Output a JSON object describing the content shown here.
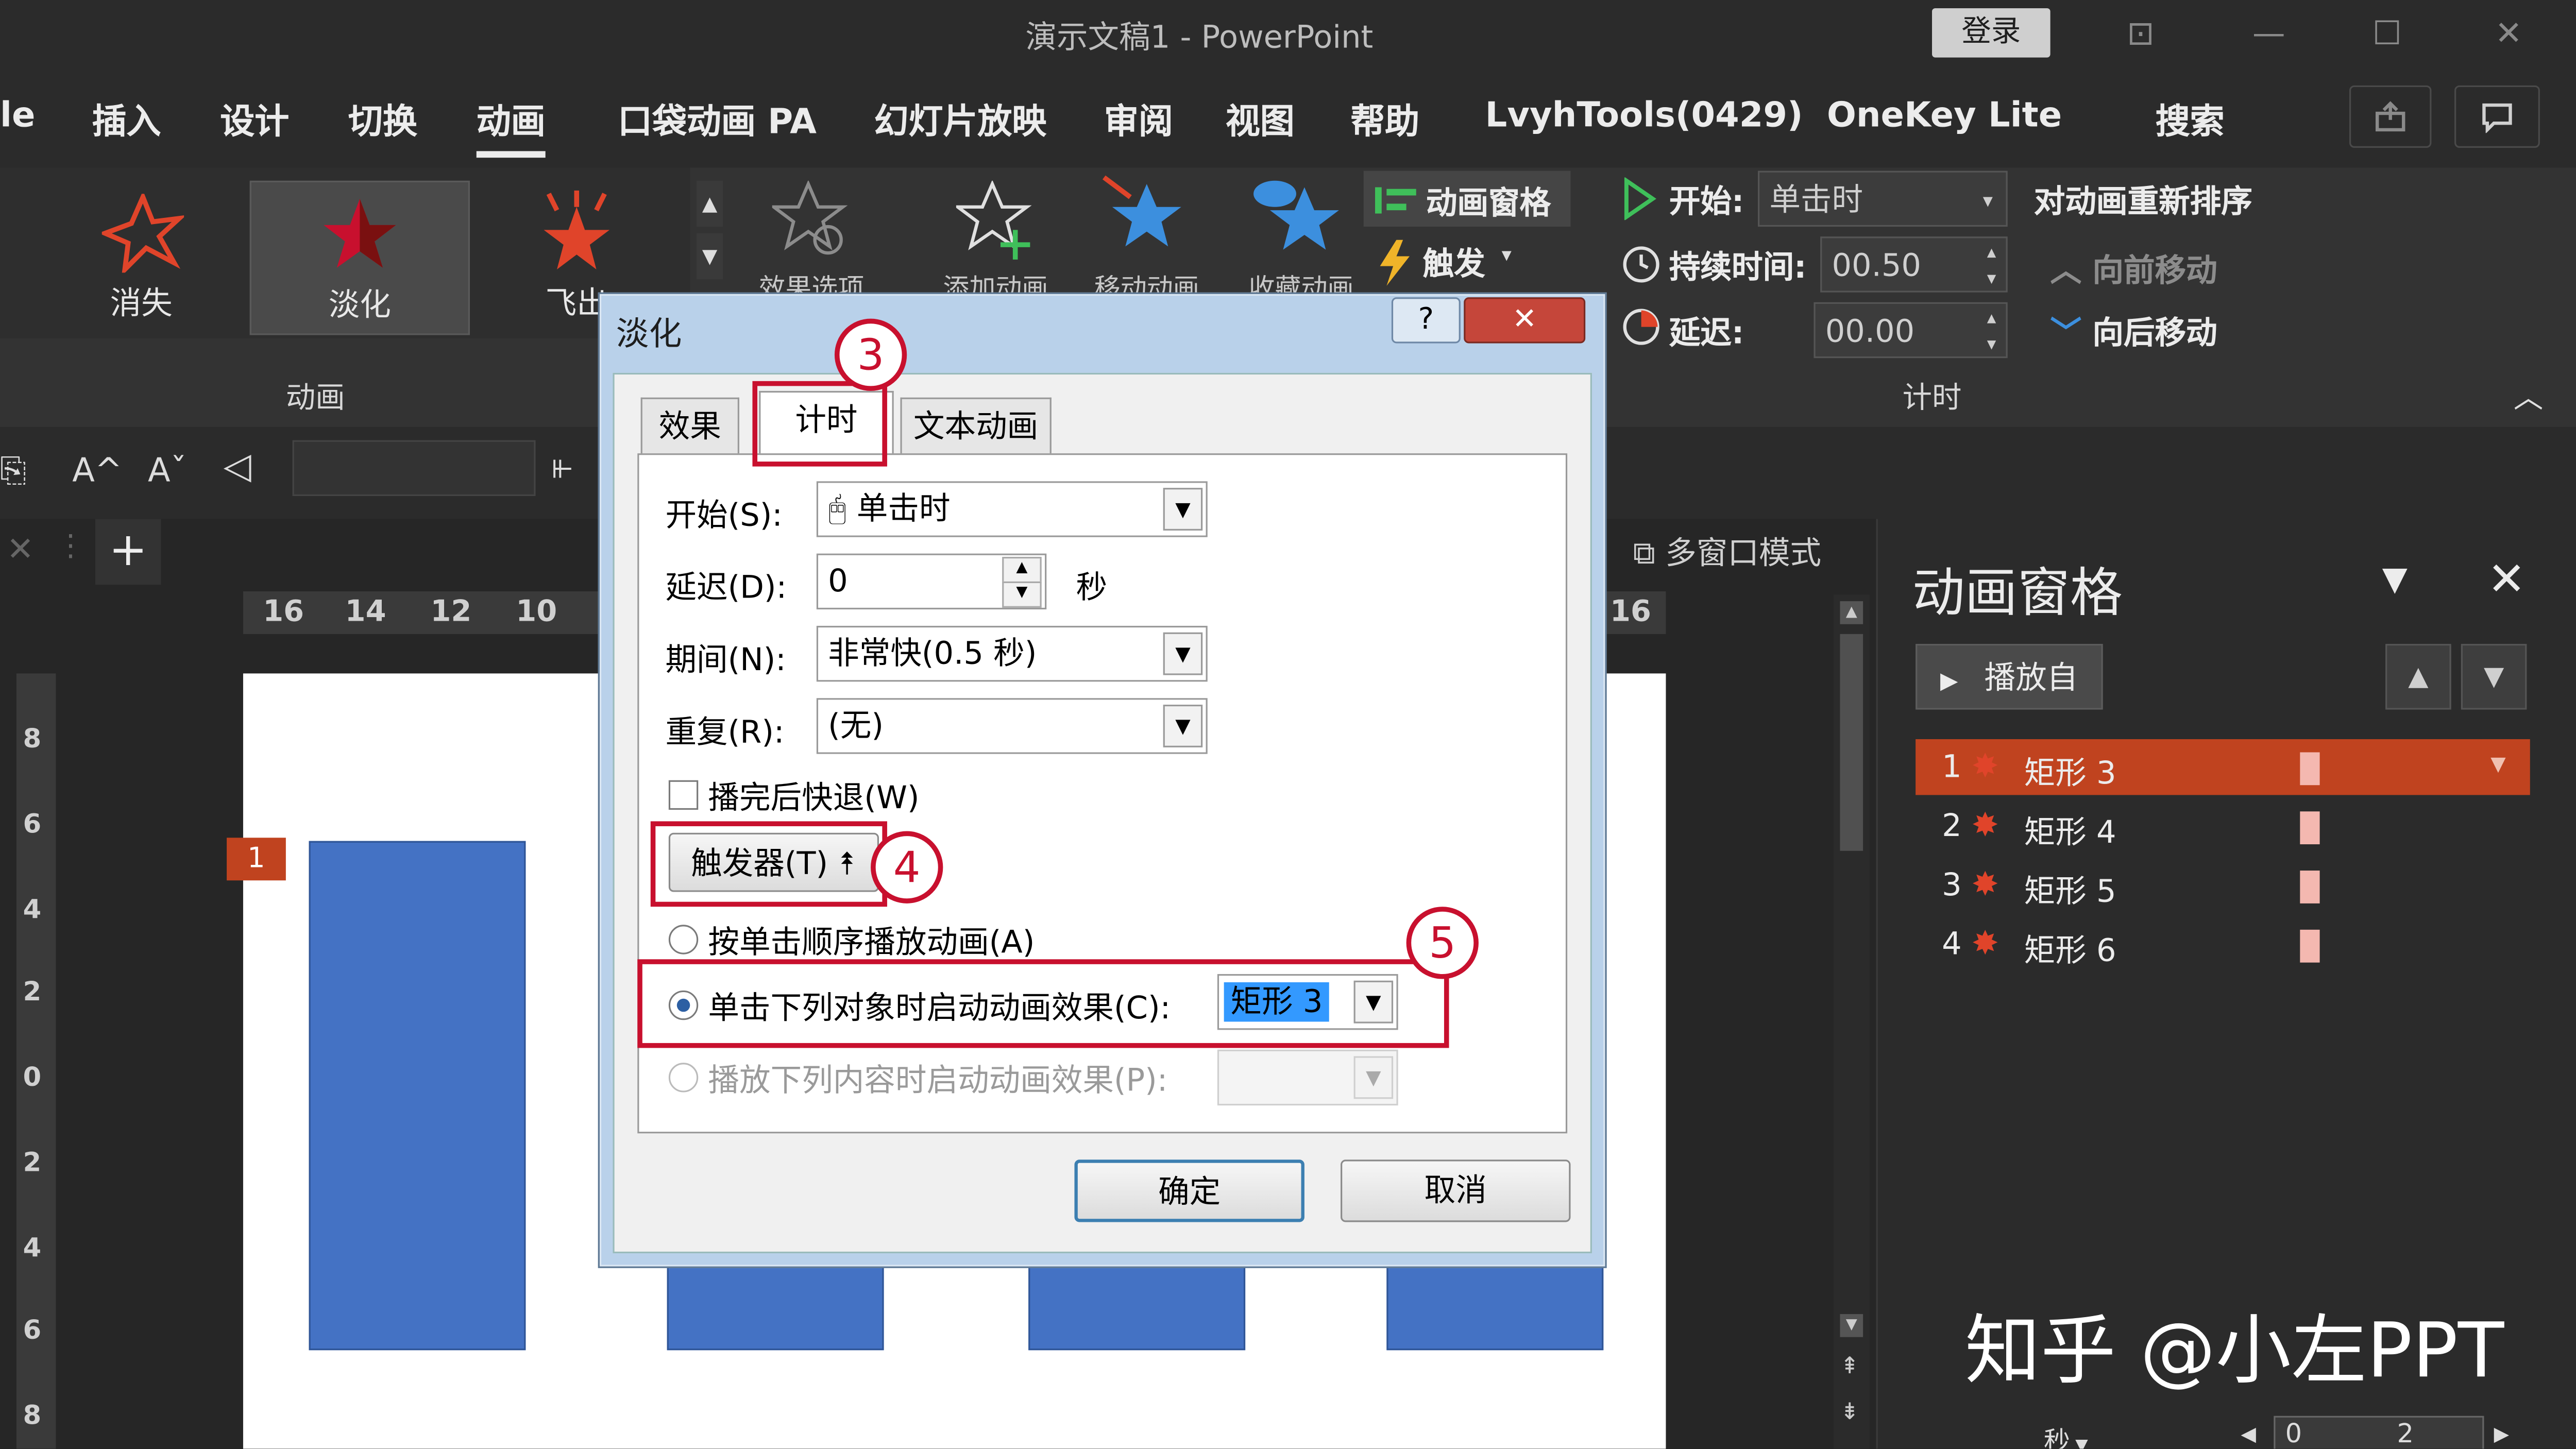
{
  "window": {
    "title": "演示文稿1  -  PowerPoint",
    "login": "登录",
    "controls": [
      "⊡",
      "—",
      "☐",
      "✕"
    ]
  },
  "menu": {
    "items": [
      "le",
      "插入",
      "设计",
      "切换",
      "动画",
      "口袋动画 PA",
      "幻灯片放映",
      "审阅",
      "视图",
      "帮助",
      "LvyhTools(0429)",
      "OneKey Lite",
      "搜索"
    ],
    "active": "动画"
  },
  "ribbon": {
    "animations": [
      "消失",
      "淡化",
      "飞出"
    ],
    "group_animation": "动画",
    "effect_options": "效果选项",
    "add_animation": "添加动画",
    "pan_animation": "移动动画",
    "collect_animation": "收藏动画",
    "anim_pane": "动画窗格",
    "trigger": "触发",
    "start_label": "开始:",
    "start_value": "单击时",
    "duration_label": "持续时间:",
    "duration_value": "00.50",
    "delay_label": "延迟:",
    "delay_value": "00.00",
    "reorder": "对动画重新排序",
    "move_earlier": "向前移动",
    "move_later": "向后移动",
    "group_timing": "计时"
  },
  "format_bar": {
    "font_up": "A^",
    "font_down": "Aˇ"
  },
  "tabs": {
    "add": "+",
    "multiwindow": "多窗口模式"
  },
  "ruler": {
    "h_labels": [
      "16",
      "14",
      "12",
      "10",
      "16"
    ],
    "v_labels": [
      "8",
      "6",
      "4",
      "2",
      "0",
      "2",
      "4",
      "6",
      "8"
    ]
  },
  "slide": {
    "marker": "1"
  },
  "dialog": {
    "title": "淡化",
    "help": "?",
    "close": "✕",
    "tabs": [
      "效果",
      "计时",
      "文本动画"
    ],
    "active_tab": "计时",
    "start_label": "开始(S):",
    "start_value": "单击时",
    "delay_label": "延迟(D):",
    "delay_value": "0",
    "delay_unit": "秒",
    "period_label": "期间(N):",
    "period_value": "非常快(0.5 秒)",
    "repeat_label": "重复(R):",
    "repeat_value": "(无)",
    "rewind_label": "播完后快退(W)",
    "trigger_btn": "触发器(T) ⯭",
    "opt_sequence": "按单击顺序播放动画(A)",
    "opt_click_object": "单击下列对象时启动动画效果(C):",
    "opt_click_object_value": "矩形 3",
    "opt_play_content": "播放下列内容时启动动画效果(P):",
    "ok": "确定",
    "cancel": "取消"
  },
  "callouts": [
    "3",
    "4",
    "5"
  ],
  "pane": {
    "title": "动画窗格",
    "play_btn": "播放自",
    "items": [
      {
        "num": "1",
        "name": "矩形 3"
      },
      {
        "num": "2",
        "name": "矩形 4"
      },
      {
        "num": "3",
        "name": "矩形 5"
      },
      {
        "num": "4",
        "name": "矩形 6"
      }
    ],
    "timeline_unit": "秒",
    "timeline_ticks": [
      "0",
      "2"
    ]
  },
  "watermark": "知乎 @小左PPT",
  "colors": {
    "accent": "#c0431f",
    "bar": "#4472c4",
    "callout": "#c8102e"
  }
}
